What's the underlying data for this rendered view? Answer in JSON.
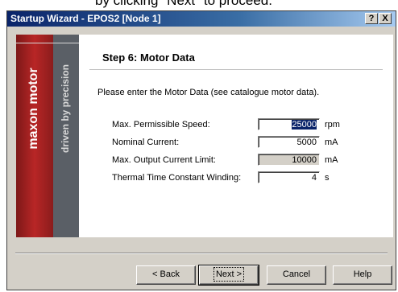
{
  "background_caption": "by clicking \"Next\" to proceed.",
  "window": {
    "title": "Startup Wizard - EPOS2 [Node 1]",
    "help_button": "?",
    "close_button": "X"
  },
  "brand": {
    "name": "maxon motor",
    "tagline": "driven by precision"
  },
  "step": {
    "title": "Step 6: Motor Data",
    "instruction": "Please enter the Motor Data (see catalogue motor data)."
  },
  "fields": [
    {
      "label": "Max. Permissible Speed:",
      "value": "25000",
      "unit": "rpm",
      "editable": true,
      "selected": true
    },
    {
      "label": "Nominal Current:",
      "value": "5000",
      "unit": "mA",
      "editable": true,
      "selected": false
    },
    {
      "label": "Max. Output Current Limit:",
      "value": "10000",
      "unit": "mA",
      "editable": false,
      "selected": false
    },
    {
      "label": "Thermal Time Constant Winding:",
      "value": "4",
      "unit": "s",
      "editable": true,
      "selected": false
    }
  ],
  "buttons": {
    "back": "< Back",
    "next": "Next >",
    "cancel": "Cancel",
    "help": "Help"
  },
  "colors": {
    "titlebar_start": "#0a246a",
    "brand_red": "#b82626",
    "brand_gray": "#5a5f66",
    "dialog_face": "#d4d0c8"
  }
}
